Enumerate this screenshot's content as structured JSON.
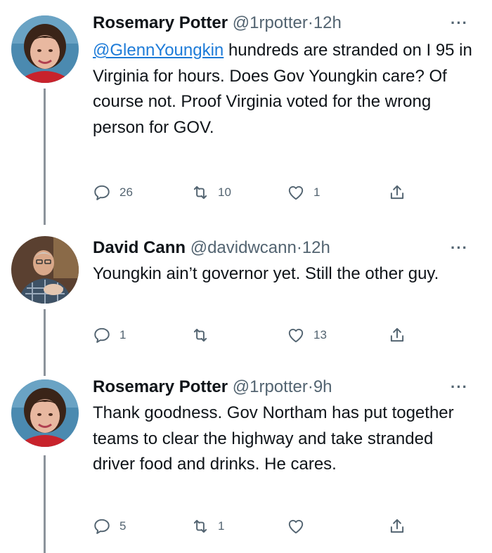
{
  "tweets": [
    {
      "name": "Rosemary Potter",
      "handle": "@1rpotter",
      "separator": "·",
      "time": "12h",
      "more": "···",
      "mention": "@GlennYoungkin",
      "text_after_mention": " hundreds are stranded on I 95 in Virginia for hours. Does Gov Youngkin care? Of course not. Proof Virginia voted for the wrong person for GOV.",
      "replies": "26",
      "retweets": "10",
      "likes": "1"
    },
    {
      "name": "David Cann",
      "handle": "@davidwcann",
      "separator": "·",
      "time": "12h",
      "more": "···",
      "text": "Youngkin ain’t governor yet. Still the other guy.",
      "replies": "1",
      "retweets": "",
      "likes": "13"
    },
    {
      "name": "Rosemary Potter",
      "handle": "@1rpotter",
      "separator": "·",
      "time": "9h",
      "more": "···",
      "text": "Thank goodness.  Gov Northam has put together teams to clear the highway and take stranded driver food and drinks.  He cares.",
      "replies": "5",
      "retweets": "1",
      "likes": ""
    }
  ],
  "icons": {
    "reply": "reply-icon",
    "retweet": "retweet-icon",
    "like": "heart-icon",
    "share": "share-icon",
    "more": "more-icon"
  },
  "colors": {
    "link": "#1d7bd8",
    "muted": "#536471",
    "text": "#0f1419",
    "thread_line": "#8c939b"
  }
}
